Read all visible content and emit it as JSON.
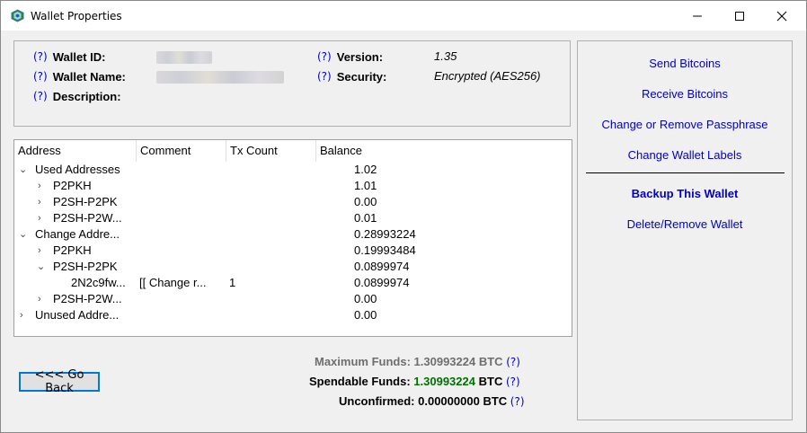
{
  "window": {
    "title": "Wallet Properties"
  },
  "info": {
    "help": "(?)",
    "wallet_id_label": "Wallet ID:",
    "wallet_name_label": "Wallet Name:",
    "description_label": "Description:",
    "version_label": "Version:",
    "version_value": "1.35",
    "security_label": "Security:",
    "security_value": "Encrypted (AES256)"
  },
  "tree": {
    "columns": [
      "Address",
      "Comment",
      "Tx Count",
      "Balance"
    ],
    "rows": [
      {
        "name": "Used Addresses",
        "comment": "",
        "tx": "",
        "balance": "1.02",
        "arrow": "expanded"
      },
      {
        "name": "P2PKH",
        "comment": "",
        "tx": "",
        "balance": "1.01",
        "arrow": "collapsed"
      },
      {
        "name": "P2SH-P2PK",
        "comment": "",
        "tx": "",
        "balance": "0.00",
        "arrow": "collapsed"
      },
      {
        "name": "P2SH-P2W...",
        "comment": "",
        "tx": "",
        "balance": "0.01",
        "arrow": "collapsed"
      },
      {
        "name": "Change Addre...",
        "comment": "",
        "tx": "",
        "balance": "0.28993224",
        "arrow": "expanded"
      },
      {
        "name": "P2PKH",
        "comment": "",
        "tx": "",
        "balance": "0.19993484",
        "arrow": "collapsed"
      },
      {
        "name": "P2SH-P2PK",
        "comment": "",
        "tx": "",
        "balance": "0.0899974",
        "arrow": "expanded"
      },
      {
        "name": "2N2c9fw...",
        "comment": "[[ Change r...",
        "tx": "1",
        "balance": "0.0899974",
        "arrow": "none"
      },
      {
        "name": "P2SH-P2W...",
        "comment": "",
        "tx": "",
        "balance": "0.00",
        "arrow": "collapsed"
      },
      {
        "name": "Unused Addre...",
        "comment": "",
        "tx": "",
        "balance": "0.00",
        "arrow": "collapsed"
      }
    ]
  },
  "funds": {
    "max_label": "Maximum Funds:",
    "max_value": "1.30993224",
    "spendable_label": "Spendable Funds:",
    "spendable_value": "1.30993224",
    "unconfirmed_label": "Unconfirmed:",
    "unconfirmed_value": "0.00000000",
    "unit": "BTC",
    "help": "(?)"
  },
  "back_button": "<<< Go Back",
  "actions": {
    "send": "Send Bitcoins",
    "receive": "Receive Bitcoins",
    "passphrase": "Change or Remove Passphrase",
    "labels": "Change Wallet Labels",
    "backup": "Backup This Wallet",
    "delete": "Delete/Remove Wallet"
  },
  "colors": {
    "link": "#0000c8",
    "spendable": "#007000",
    "max_funds": "#6e6e6e"
  }
}
